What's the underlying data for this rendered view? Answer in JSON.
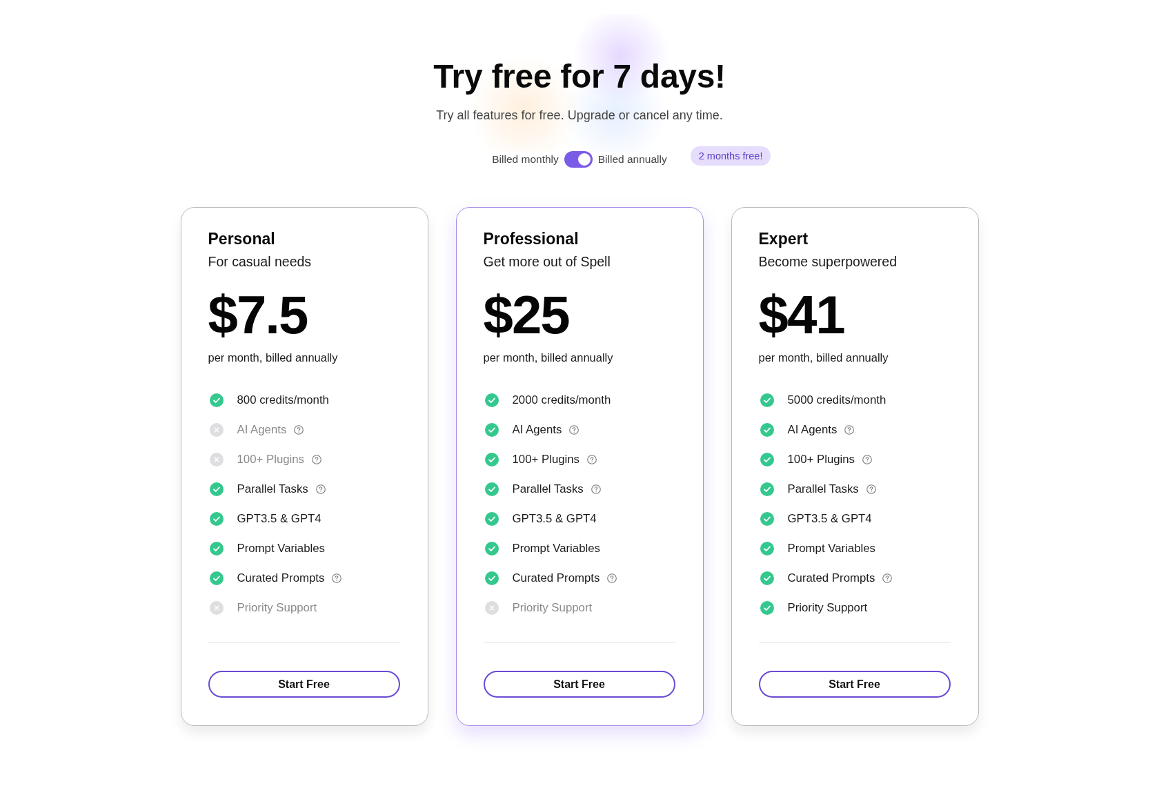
{
  "header": {
    "title": "Try free for 7 days!",
    "subtitle": "Try all features for free. Upgrade or cancel any time."
  },
  "billing": {
    "monthly_label": "Billed monthly",
    "annual": true,
    "annual_label": "Billed annually",
    "badge": "2 months free!"
  },
  "plans": [
    {
      "name": "Personal",
      "tagline": "For casual needs",
      "price": "$7.5",
      "price_note": "per month, billed annually",
      "highlighted": false,
      "features": [
        {
          "label": "800 credits/month",
          "included": true,
          "info": false
        },
        {
          "label": "AI Agents",
          "included": false,
          "info": true
        },
        {
          "label": "100+ Plugins",
          "included": false,
          "info": true
        },
        {
          "label": "Parallel Tasks",
          "included": true,
          "info": true
        },
        {
          "label": "GPT3.5 & GPT4",
          "included": true,
          "info": false
        },
        {
          "label": "Prompt Variables",
          "included": true,
          "info": false
        },
        {
          "label": "Curated Prompts",
          "included": true,
          "info": true
        },
        {
          "label": "Priority Support",
          "included": false,
          "info": false
        }
      ],
      "button": "Start Free"
    },
    {
      "name": "Professional",
      "tagline": "Get more out of Spell",
      "price": "$25",
      "price_note": "per month, billed annually",
      "highlighted": true,
      "features": [
        {
          "label": "2000 credits/month",
          "included": true,
          "info": false
        },
        {
          "label": "AI Agents",
          "included": true,
          "info": true
        },
        {
          "label": "100+ Plugins",
          "included": true,
          "info": true
        },
        {
          "label": "Parallel Tasks",
          "included": true,
          "info": true
        },
        {
          "label": "GPT3.5 & GPT4",
          "included": true,
          "info": false
        },
        {
          "label": "Prompt Variables",
          "included": true,
          "info": false
        },
        {
          "label": "Curated Prompts",
          "included": true,
          "info": true
        },
        {
          "label": "Priority Support",
          "included": false,
          "info": false
        }
      ],
      "button": "Start Free"
    },
    {
      "name": "Expert",
      "tagline": "Become superpowered",
      "price": "$41",
      "price_note": "per month, billed annually",
      "highlighted": false,
      "features": [
        {
          "label": "5000 credits/month",
          "included": true,
          "info": false
        },
        {
          "label": "AI Agents",
          "included": true,
          "info": true
        },
        {
          "label": "100+ Plugins",
          "included": true,
          "info": true
        },
        {
          "label": "Parallel Tasks",
          "included": true,
          "info": true
        },
        {
          "label": "GPT3.5 & GPT4",
          "included": true,
          "info": false
        },
        {
          "label": "Prompt Variables",
          "included": true,
          "info": false
        },
        {
          "label": "Curated Prompts",
          "included": true,
          "info": true
        },
        {
          "label": "Priority Support",
          "included": true,
          "info": false
        }
      ],
      "button": "Start Free"
    }
  ]
}
